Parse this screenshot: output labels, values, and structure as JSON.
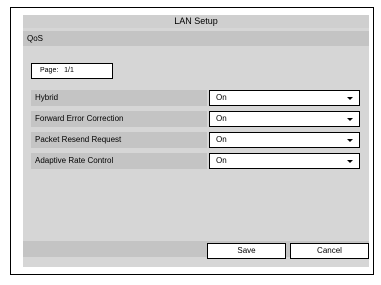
{
  "window": {
    "title": "LAN Setup"
  },
  "section": {
    "title": "QoS"
  },
  "page_indicator": {
    "label": "Page:",
    "value": "1/1"
  },
  "settings": [
    {
      "label": "Hybrid",
      "value": "On"
    },
    {
      "label": "Forward Error Correction",
      "value": "On"
    },
    {
      "label": "Packet Resend Request",
      "value": "On"
    },
    {
      "label": "Adaptive Rate Control",
      "value": "On"
    }
  ],
  "buttons": {
    "save": "Save",
    "cancel": "Cancel"
  }
}
